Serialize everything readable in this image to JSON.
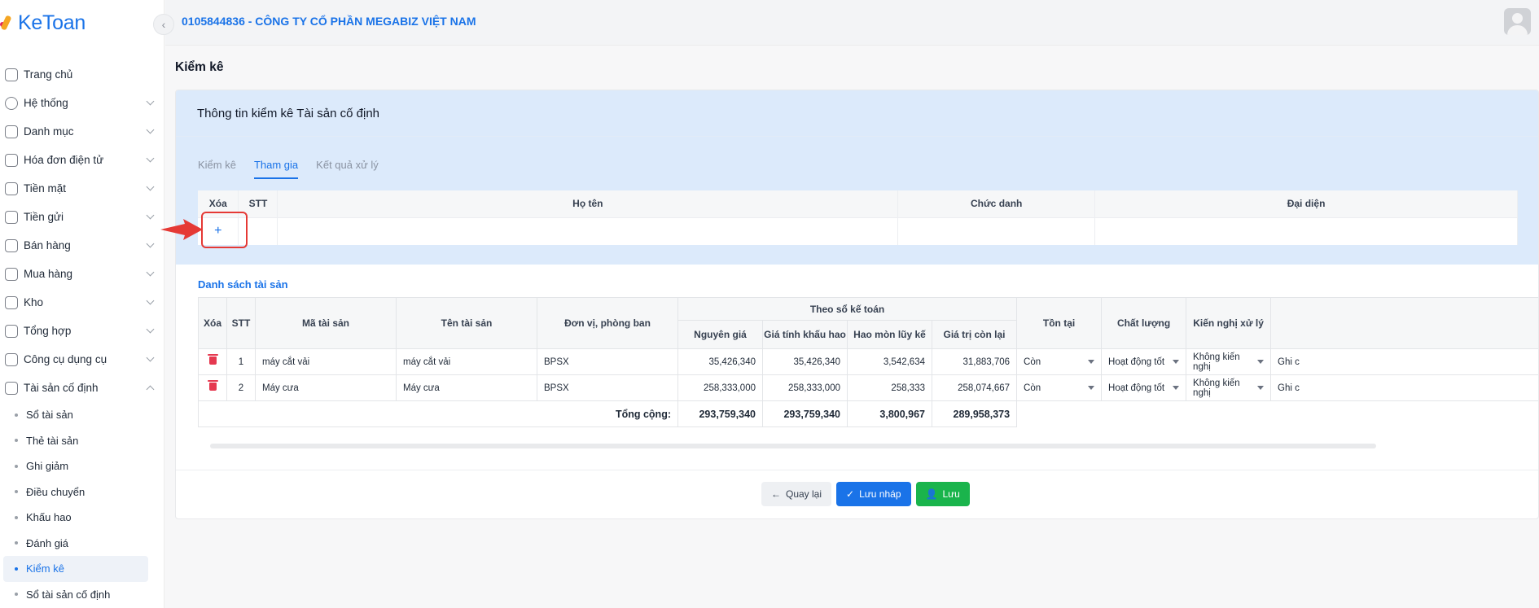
{
  "app": {
    "logo_text": "KeToan"
  },
  "header": {
    "company": "0105844836 - CÔNG TY CỔ PHẦN MEGABIZ VIỆT NAM"
  },
  "sidebar": {
    "items": [
      {
        "label": "Trang chủ",
        "icon": "home-icon"
      },
      {
        "label": "Hệ thống",
        "icon": "gear-icon"
      },
      {
        "label": "Danh mục",
        "icon": "grid-icon"
      },
      {
        "label": "Hóa đơn điện tử",
        "icon": "invoice-icon"
      },
      {
        "label": "Tiền mặt",
        "icon": "cash-icon"
      },
      {
        "label": "Tiền gửi",
        "icon": "bank-icon"
      },
      {
        "label": "Bán hàng",
        "icon": "sales-icon"
      },
      {
        "label": "Mua hàng",
        "icon": "cart-icon"
      },
      {
        "label": "Kho",
        "icon": "warehouse-icon"
      },
      {
        "label": "Tổng hợp",
        "icon": "chart-icon"
      },
      {
        "label": "Công cụ dụng cụ",
        "icon": "tools-icon"
      },
      {
        "label": "Tài sản cố định",
        "icon": "asset-icon"
      }
    ],
    "subitems": [
      "Sổ tài sản",
      "Thẻ tài sản",
      "Ghi giảm",
      "Điều chuyển",
      "Khấu hao",
      "Đánh giá",
      "Kiểm kê",
      "Sổ tài sản cố định"
    ],
    "active_sub": "Kiểm kê"
  },
  "page": {
    "title": "Kiểm kê"
  },
  "card": {
    "title": "Thông tin kiểm kê Tài sản cố định",
    "tabs": [
      "Kiểm kê",
      "Tham gia",
      "Kết quả xử lý"
    ],
    "active_tab": "Tham gia",
    "participants": {
      "headers": [
        "Xóa",
        "STT",
        "Họ tên",
        "Chức danh",
        "Đại diện"
      ],
      "add_label": "+"
    }
  },
  "assets": {
    "title": "Danh sách tài sản",
    "headers": {
      "xoa": "Xóa",
      "stt": "STT",
      "ma": "Mã tài sản",
      "ten": "Tên tài sản",
      "donvi": "Đơn vị, phòng ban",
      "group": "Theo sổ kế toán",
      "nguyengia": "Nguyên giá",
      "giatinh": "Giá tính khấu hao",
      "haomon": "Hao mòn lũy kế",
      "conlai": "Giá trị còn lại",
      "tontai": "Tồn tại",
      "chatluong": "Chất lượng",
      "kiennghi": "Kiến nghị xử lý"
    },
    "rows": [
      {
        "stt": "1",
        "ma": "máy cắt vải",
        "ten": "máy cắt vải",
        "donvi": "BPSX",
        "nguyengia": "35,426,340",
        "giatinh": "35,426,340",
        "haomon": "3,542,634",
        "conlai": "31,883,706",
        "tontai": "Còn",
        "chatluong": "Hoạt động tốt",
        "kiennghi": "Không kiến nghị",
        "ghichu": "Ghi c"
      },
      {
        "stt": "2",
        "ma": "Máy cưa",
        "ten": "Máy cưa",
        "donvi": "BPSX",
        "nguyengia": "258,333,000",
        "giatinh": "258,333,000",
        "haomon": "258,333",
        "conlai": "258,074,667",
        "tontai": "Còn",
        "chatluong": "Hoạt động tốt",
        "kiennghi": "Không kiến nghị",
        "ghichu": "Ghi c"
      }
    ],
    "total": {
      "label": "Tổng cộng:",
      "nguyengia": "293,759,340",
      "giatinh": "293,759,340",
      "haomon": "3,800,967",
      "conlai": "289,958,373"
    }
  },
  "actions": {
    "back": "Quay lại",
    "draft": "Lưu nháp",
    "save": "Lưu"
  },
  "colors": {
    "accent": "#1a73e8",
    "save": "#1ab44c",
    "delete": "#e53950",
    "highlight": "#e53935"
  }
}
